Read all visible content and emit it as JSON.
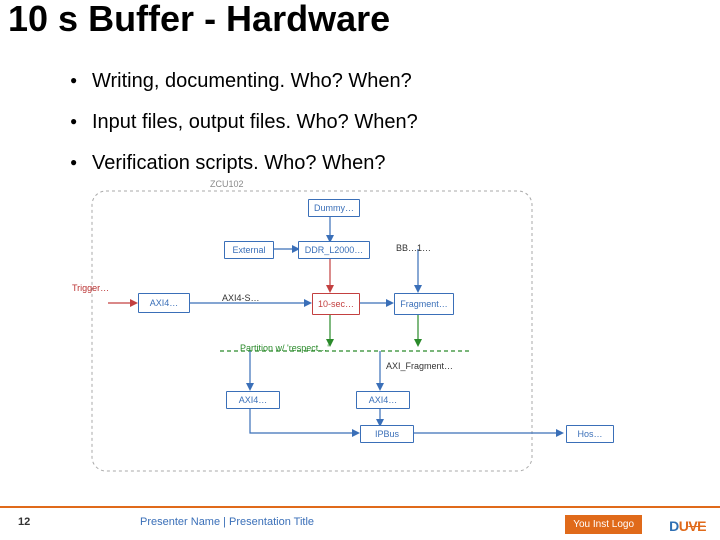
{
  "title": "10 s Buffer - Hardware",
  "bullets": [
    "Writing, documenting. Who? When?",
    "Input files, output files. Who? When?",
    "Verification scripts. Who? When?"
  ],
  "diagram": {
    "boxes": {
      "zcu": "ZCU102",
      "dummy": "Dummy…",
      "external": "External",
      "ddr": "DDR_L2000…",
      "bb": "BB…1…",
      "trigger": "Trigger…",
      "axi_l": "AXI4…",
      "axi_s_top": "AXI4-S…",
      "tensec": "10-sec…",
      "fragment": "Fragment…",
      "partition": "Partition w/ 'respect…'",
      "axi_frag": "AXI_Fragment…",
      "axi_bl": "AXI4…",
      "axi_br": "AXI4…",
      "ipbus": "IPBus",
      "host": "Hos…"
    }
  },
  "footer": {
    "page": "12",
    "text": "Presenter Name | Presentation Title",
    "inst": "You Inst Logo",
    "brand_d": "D",
    "brand_u": "U",
    "brand_e": "VE"
  }
}
